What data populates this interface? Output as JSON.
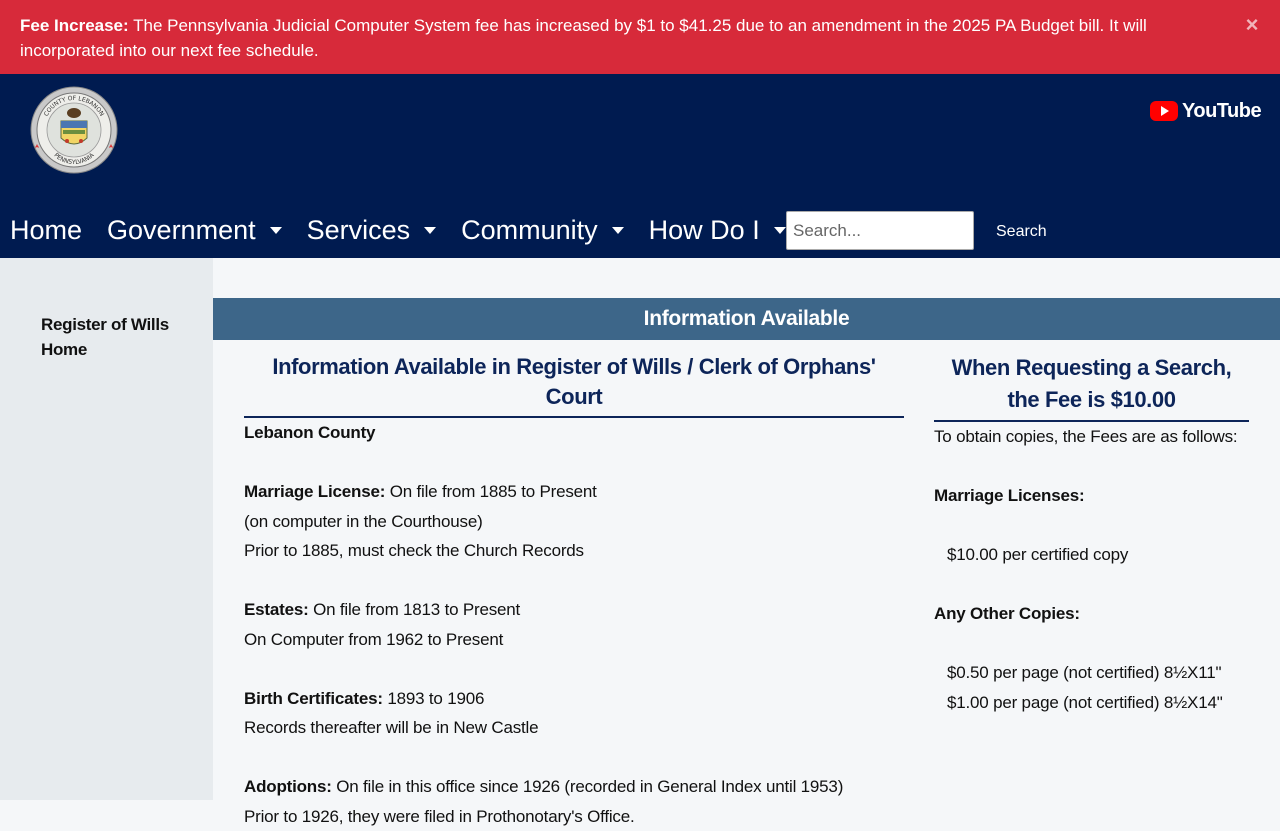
{
  "alert": {
    "label": "Fee Increase:",
    "message": " The Pennsylvania Judicial Computer System fee has increased by $1 to $41.25 due to an amendment in the 2025 PA Budget bill. It will incorporated into our next fee schedule.",
    "close_glyph": "×"
  },
  "header": {
    "seal_top_text": "COUNTY OF LEBANON",
    "seal_bottom_text": "PENNSYLVANIA",
    "youtube_label": "YouTube"
  },
  "nav": {
    "items": [
      {
        "label": "Home"
      },
      {
        "label": "Government"
      },
      {
        "label": "Services"
      },
      {
        "label": "Community"
      },
      {
        "label": "How Do I"
      }
    ],
    "search_placeholder": "Search...",
    "search_button": "Search"
  },
  "sidebar": {
    "link": "Register of Wills Home"
  },
  "main": {
    "section_title": "Information Available",
    "left": {
      "title": "Information Available in Register of Wills / Clerk of Orphans' Court",
      "county": "Lebanon County",
      "marriage_label": "Marriage License:",
      "marriage_1": " On file from 1885 to Present",
      "marriage_2": "(on computer in the Courthouse)",
      "marriage_3": "Prior to 1885, must check the Church Records",
      "estates_label": "Estates:",
      "estates_1": " On file from 1813 to Present",
      "estates_2": "On Computer from 1962 to Present",
      "birth_label": "Birth Certificates:",
      "birth_1": " 1893 to 1906",
      "birth_2": "Records thereafter will be in New Castle",
      "adoptions_label": "Adoptions:",
      "adoptions_1": " On file in this office since 1926 (recorded in General Index until 1953)",
      "adoptions_2": "Prior to 1926, they were filed in Prothonotary's Office."
    },
    "right": {
      "title": "When Requesting a Search, the Fee is $10.00",
      "intro": "To obtain copies, the Fees are as follows:",
      "marriage_label": "Marriage Licenses:",
      "marriage_fee": "$10.00 per certified copy",
      "other_label": "Any Other Copies:",
      "other_fee_1": "$0.50 per page (not certified) 8½X11\"",
      "other_fee_2": "$1.00 per page (not certified) 8½X14\""
    }
  },
  "colors": {
    "alert_bg": "#d72a3a",
    "header_bg": "#001b50",
    "section_bar": "#3d6689",
    "title_color": "#0d2559"
  }
}
